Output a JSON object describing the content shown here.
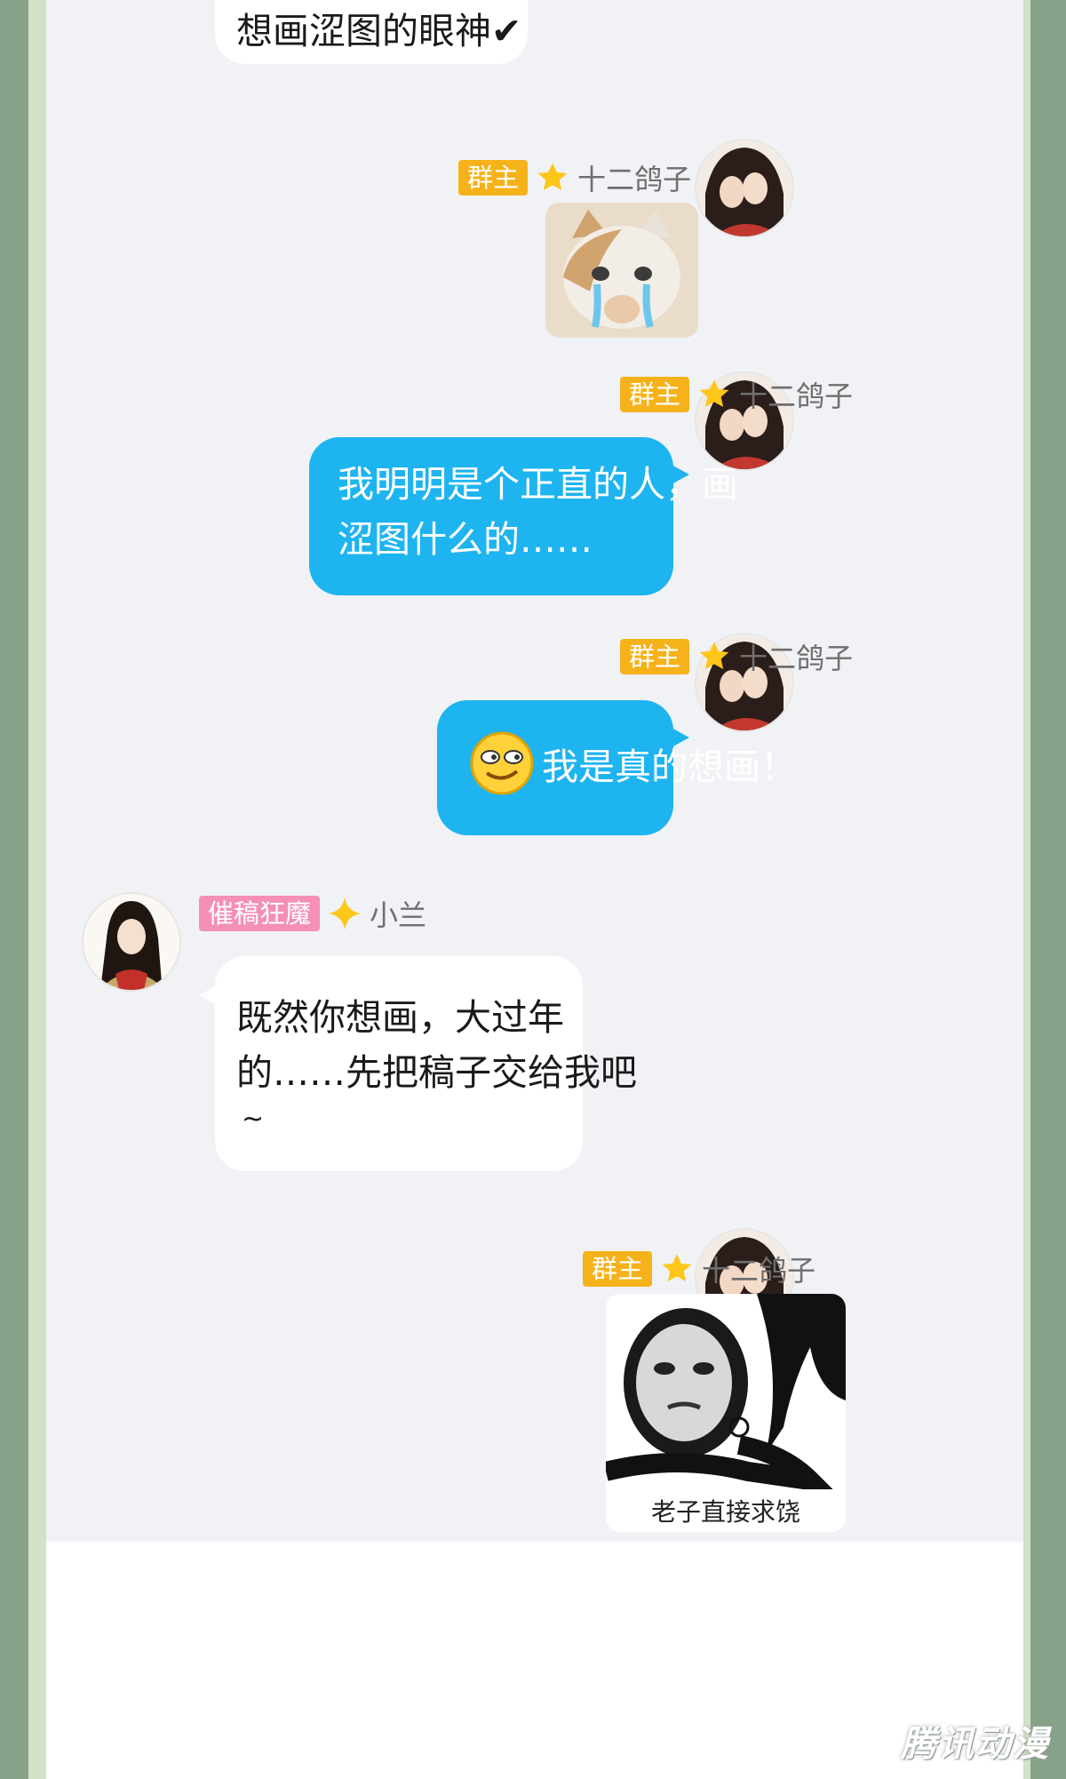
{
  "messages": {
    "m1": {
      "text": "想画涩图的眼神",
      "check": "✔"
    },
    "m2": {
      "badge": "群主",
      "name": "十二鸽子",
      "sticker_icon": "crying-cat-sticker"
    },
    "m3": {
      "badge": "群主",
      "name": "十二鸽子",
      "line1": "我明明是个正直的人，画",
      "line2": "涩图什么的……"
    },
    "m4": {
      "badge": "群主",
      "name": "十二鸽子",
      "emoji_icon": "smirk-emoji-icon",
      "text": "我是真的想画！"
    },
    "m5": {
      "badge": "催稿狂魔",
      "name": "小兰",
      "line1": "既然你想画，大过年",
      "line2": "的……先把稿子交给我吧",
      "line3": "~"
    },
    "m6": {
      "badge": "群主",
      "name": "十二鸽子",
      "sticker_caption": "老子直接求饶",
      "sticker_icon": "begging-meme-sticker"
    }
  },
  "watermark": "腾讯动漫",
  "colors": {
    "outer_frame": "#86a289",
    "inner_frame": "#d4e1c9",
    "chat_background": "#f0f2f5",
    "blue_bubble": "#1eb4f0",
    "owner_badge": "#f6b21b",
    "pink_badge": "#f48fb8"
  }
}
